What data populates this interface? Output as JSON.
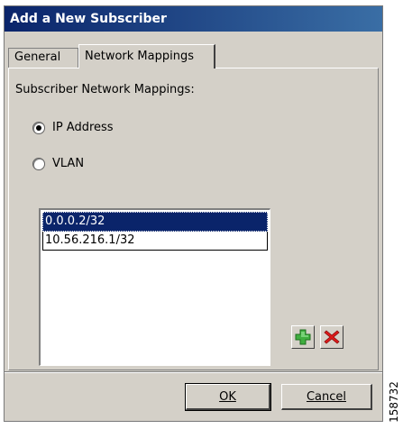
{
  "window": {
    "title": "Add a New Subscriber"
  },
  "tabs": [
    {
      "label": "General",
      "active": false
    },
    {
      "label": "Network Mappings",
      "active": true
    }
  ],
  "panel": {
    "section_label": "Subscriber Network Mappings:",
    "radios": [
      {
        "label": "IP Address",
        "checked": true
      },
      {
        "label": "VLAN",
        "checked": false
      }
    ],
    "mappings": [
      {
        "value": "0.0.0.2/32",
        "selected": true
      },
      {
        "value": "10.56.216.1/32",
        "selected": false
      }
    ],
    "add_icon": "plus-icon",
    "remove_icon": "x-icon",
    "add_color": "#2e8b2e",
    "remove_color": "#cc1111"
  },
  "buttons": {
    "ok_label": "OK",
    "cancel_label": "Cancel"
  },
  "figure_number": "158732"
}
